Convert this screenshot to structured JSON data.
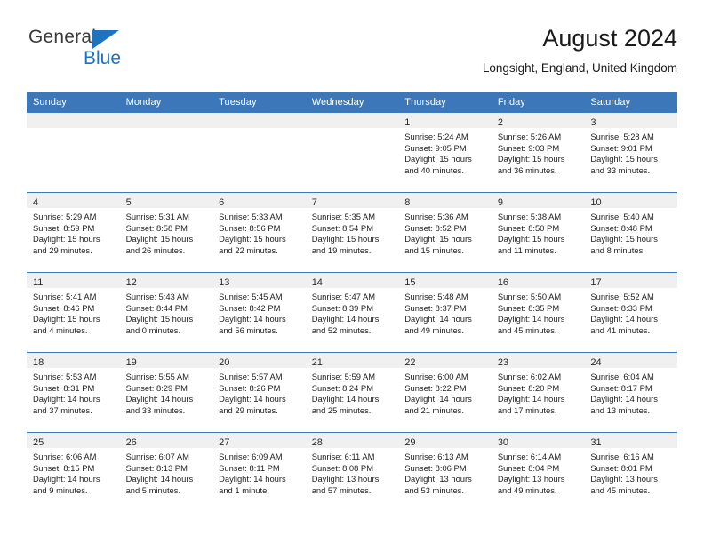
{
  "brand": {
    "name_part1": "General",
    "name_part2": "Blue",
    "accent_color": "#1f72bd"
  },
  "header": {
    "title": "August 2024",
    "subtitle": "Longsight, England, United Kingdom"
  },
  "theme": {
    "header_blue": "#3b77b9",
    "daynum_band": "#f0f0f0"
  },
  "weekdays": [
    "Sunday",
    "Monday",
    "Tuesday",
    "Wednesday",
    "Thursday",
    "Friday",
    "Saturday"
  ],
  "weeks": [
    [
      {
        "day": "",
        "sunrise": "",
        "sunset": "",
        "daylight1": "",
        "daylight2": "",
        "empty": true
      },
      {
        "day": "",
        "sunrise": "",
        "sunset": "",
        "daylight1": "",
        "daylight2": "",
        "empty": true
      },
      {
        "day": "",
        "sunrise": "",
        "sunset": "",
        "daylight1": "",
        "daylight2": "",
        "empty": true
      },
      {
        "day": "",
        "sunrise": "",
        "sunset": "",
        "daylight1": "",
        "daylight2": "",
        "empty": true
      },
      {
        "day": "1",
        "sunrise": "Sunrise: 5:24 AM",
        "sunset": "Sunset: 9:05 PM",
        "daylight1": "Daylight: 15 hours",
        "daylight2": "and 40 minutes."
      },
      {
        "day": "2",
        "sunrise": "Sunrise: 5:26 AM",
        "sunset": "Sunset: 9:03 PM",
        "daylight1": "Daylight: 15 hours",
        "daylight2": "and 36 minutes."
      },
      {
        "day": "3",
        "sunrise": "Sunrise: 5:28 AM",
        "sunset": "Sunset: 9:01 PM",
        "daylight1": "Daylight: 15 hours",
        "daylight2": "and 33 minutes."
      }
    ],
    [
      {
        "day": "4",
        "sunrise": "Sunrise: 5:29 AM",
        "sunset": "Sunset: 8:59 PM",
        "daylight1": "Daylight: 15 hours",
        "daylight2": "and 29 minutes."
      },
      {
        "day": "5",
        "sunrise": "Sunrise: 5:31 AM",
        "sunset": "Sunset: 8:58 PM",
        "daylight1": "Daylight: 15 hours",
        "daylight2": "and 26 minutes."
      },
      {
        "day": "6",
        "sunrise": "Sunrise: 5:33 AM",
        "sunset": "Sunset: 8:56 PM",
        "daylight1": "Daylight: 15 hours",
        "daylight2": "and 22 minutes."
      },
      {
        "day": "7",
        "sunrise": "Sunrise: 5:35 AM",
        "sunset": "Sunset: 8:54 PM",
        "daylight1": "Daylight: 15 hours",
        "daylight2": "and 19 minutes."
      },
      {
        "day": "8",
        "sunrise": "Sunrise: 5:36 AM",
        "sunset": "Sunset: 8:52 PM",
        "daylight1": "Daylight: 15 hours",
        "daylight2": "and 15 minutes."
      },
      {
        "day": "9",
        "sunrise": "Sunrise: 5:38 AM",
        "sunset": "Sunset: 8:50 PM",
        "daylight1": "Daylight: 15 hours",
        "daylight2": "and 11 minutes."
      },
      {
        "day": "10",
        "sunrise": "Sunrise: 5:40 AM",
        "sunset": "Sunset: 8:48 PM",
        "daylight1": "Daylight: 15 hours",
        "daylight2": "and 8 minutes."
      }
    ],
    [
      {
        "day": "11",
        "sunrise": "Sunrise: 5:41 AM",
        "sunset": "Sunset: 8:46 PM",
        "daylight1": "Daylight: 15 hours",
        "daylight2": "and 4 minutes."
      },
      {
        "day": "12",
        "sunrise": "Sunrise: 5:43 AM",
        "sunset": "Sunset: 8:44 PM",
        "daylight1": "Daylight: 15 hours",
        "daylight2": "and 0 minutes."
      },
      {
        "day": "13",
        "sunrise": "Sunrise: 5:45 AM",
        "sunset": "Sunset: 8:42 PM",
        "daylight1": "Daylight: 14 hours",
        "daylight2": "and 56 minutes."
      },
      {
        "day": "14",
        "sunrise": "Sunrise: 5:47 AM",
        "sunset": "Sunset: 8:39 PM",
        "daylight1": "Daylight: 14 hours",
        "daylight2": "and 52 minutes."
      },
      {
        "day": "15",
        "sunrise": "Sunrise: 5:48 AM",
        "sunset": "Sunset: 8:37 PM",
        "daylight1": "Daylight: 14 hours",
        "daylight2": "and 49 minutes."
      },
      {
        "day": "16",
        "sunrise": "Sunrise: 5:50 AM",
        "sunset": "Sunset: 8:35 PM",
        "daylight1": "Daylight: 14 hours",
        "daylight2": "and 45 minutes."
      },
      {
        "day": "17",
        "sunrise": "Sunrise: 5:52 AM",
        "sunset": "Sunset: 8:33 PM",
        "daylight1": "Daylight: 14 hours",
        "daylight2": "and 41 minutes."
      }
    ],
    [
      {
        "day": "18",
        "sunrise": "Sunrise: 5:53 AM",
        "sunset": "Sunset: 8:31 PM",
        "daylight1": "Daylight: 14 hours",
        "daylight2": "and 37 minutes."
      },
      {
        "day": "19",
        "sunrise": "Sunrise: 5:55 AM",
        "sunset": "Sunset: 8:29 PM",
        "daylight1": "Daylight: 14 hours",
        "daylight2": "and 33 minutes."
      },
      {
        "day": "20",
        "sunrise": "Sunrise: 5:57 AM",
        "sunset": "Sunset: 8:26 PM",
        "daylight1": "Daylight: 14 hours",
        "daylight2": "and 29 minutes."
      },
      {
        "day": "21",
        "sunrise": "Sunrise: 5:59 AM",
        "sunset": "Sunset: 8:24 PM",
        "daylight1": "Daylight: 14 hours",
        "daylight2": "and 25 minutes."
      },
      {
        "day": "22",
        "sunrise": "Sunrise: 6:00 AM",
        "sunset": "Sunset: 8:22 PM",
        "daylight1": "Daylight: 14 hours",
        "daylight2": "and 21 minutes."
      },
      {
        "day": "23",
        "sunrise": "Sunrise: 6:02 AM",
        "sunset": "Sunset: 8:20 PM",
        "daylight1": "Daylight: 14 hours",
        "daylight2": "and 17 minutes."
      },
      {
        "day": "24",
        "sunrise": "Sunrise: 6:04 AM",
        "sunset": "Sunset: 8:17 PM",
        "daylight1": "Daylight: 14 hours",
        "daylight2": "and 13 minutes."
      }
    ],
    [
      {
        "day": "25",
        "sunrise": "Sunrise: 6:06 AM",
        "sunset": "Sunset: 8:15 PM",
        "daylight1": "Daylight: 14 hours",
        "daylight2": "and 9 minutes."
      },
      {
        "day": "26",
        "sunrise": "Sunrise: 6:07 AM",
        "sunset": "Sunset: 8:13 PM",
        "daylight1": "Daylight: 14 hours",
        "daylight2": "and 5 minutes."
      },
      {
        "day": "27",
        "sunrise": "Sunrise: 6:09 AM",
        "sunset": "Sunset: 8:11 PM",
        "daylight1": "Daylight: 14 hours",
        "daylight2": "and 1 minute."
      },
      {
        "day": "28",
        "sunrise": "Sunrise: 6:11 AM",
        "sunset": "Sunset: 8:08 PM",
        "daylight1": "Daylight: 13 hours",
        "daylight2": "and 57 minutes."
      },
      {
        "day": "29",
        "sunrise": "Sunrise: 6:13 AM",
        "sunset": "Sunset: 8:06 PM",
        "daylight1": "Daylight: 13 hours",
        "daylight2": "and 53 minutes."
      },
      {
        "day": "30",
        "sunrise": "Sunrise: 6:14 AM",
        "sunset": "Sunset: 8:04 PM",
        "daylight1": "Daylight: 13 hours",
        "daylight2": "and 49 minutes."
      },
      {
        "day": "31",
        "sunrise": "Sunrise: 6:16 AM",
        "sunset": "Sunset: 8:01 PM",
        "daylight1": "Daylight: 13 hours",
        "daylight2": "and 45 minutes."
      }
    ]
  ]
}
